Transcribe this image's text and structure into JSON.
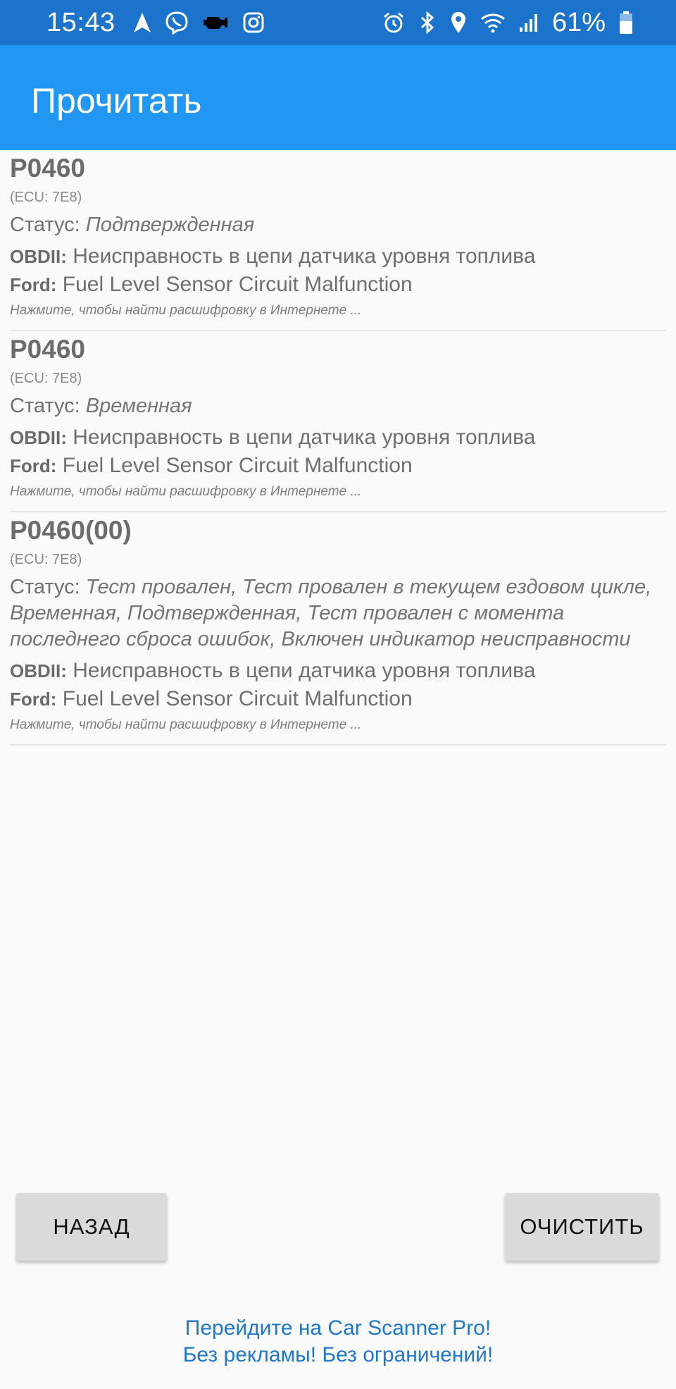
{
  "status_bar": {
    "time": "15:43",
    "left_icons": [
      "navigation-icon",
      "viber-icon",
      "check-engine-icon",
      "instagram-icon"
    ],
    "right_icons": [
      "alarm-icon",
      "bluetooth-icon",
      "location-icon",
      "wifi-icon",
      "signal-icon"
    ],
    "battery": "61%"
  },
  "app_bar": {
    "title": "Прочитать",
    "color": "#2196f3"
  },
  "entries": [
    {
      "code": "P0460",
      "ecu": "(ECU: 7E8)",
      "status_label": "Статус: ",
      "status_value": "Подтвержденная",
      "obd_label": "OBDII:",
      "obd_text": " Неисправность в цепи датчика уровня топлива",
      "maker_label": "Ford:",
      "maker_text": " Fuel Level Sensor Circuit Malfunction",
      "hint": "Нажмите, чтобы найти расшифровку в Интернете ..."
    },
    {
      "code": "P0460",
      "ecu": "(ECU: 7E8)",
      "status_label": "Статус: ",
      "status_value": "Временная",
      "obd_label": "OBDII:",
      "obd_text": " Неисправность в цепи датчика уровня топлива",
      "maker_label": "Ford:",
      "maker_text": " Fuel Level Sensor Circuit Malfunction",
      "hint": "Нажмите, чтобы найти расшифровку в Интернете ..."
    },
    {
      "code": "P0460(00)",
      "ecu": "(ECU: 7E8)",
      "status_label": "Статус: ",
      "status_value": "Тест провален, Тест провален в текущем ездовом цикле, Временная, Подтвержденная, Тест провален с момента последнего сброса ошибок, Включен индикатор неисправности",
      "obd_label": "OBDII:",
      "obd_text": " Неисправность в цепи датчика уровня топлива",
      "maker_label": "Ford:",
      "maker_text": " Fuel Level Sensor Circuit Malfunction",
      "hint": "Нажмите, чтобы найти расшифровку в Интернете ..."
    }
  ],
  "buttons": {
    "back": "НАЗАД",
    "clear": "ОЧИСТИТЬ"
  },
  "promo": {
    "line1": "Перейдите на Car Scanner Pro!",
    "line2": "Без рекламы! Без ограничений!",
    "color": "#1e78cc"
  }
}
